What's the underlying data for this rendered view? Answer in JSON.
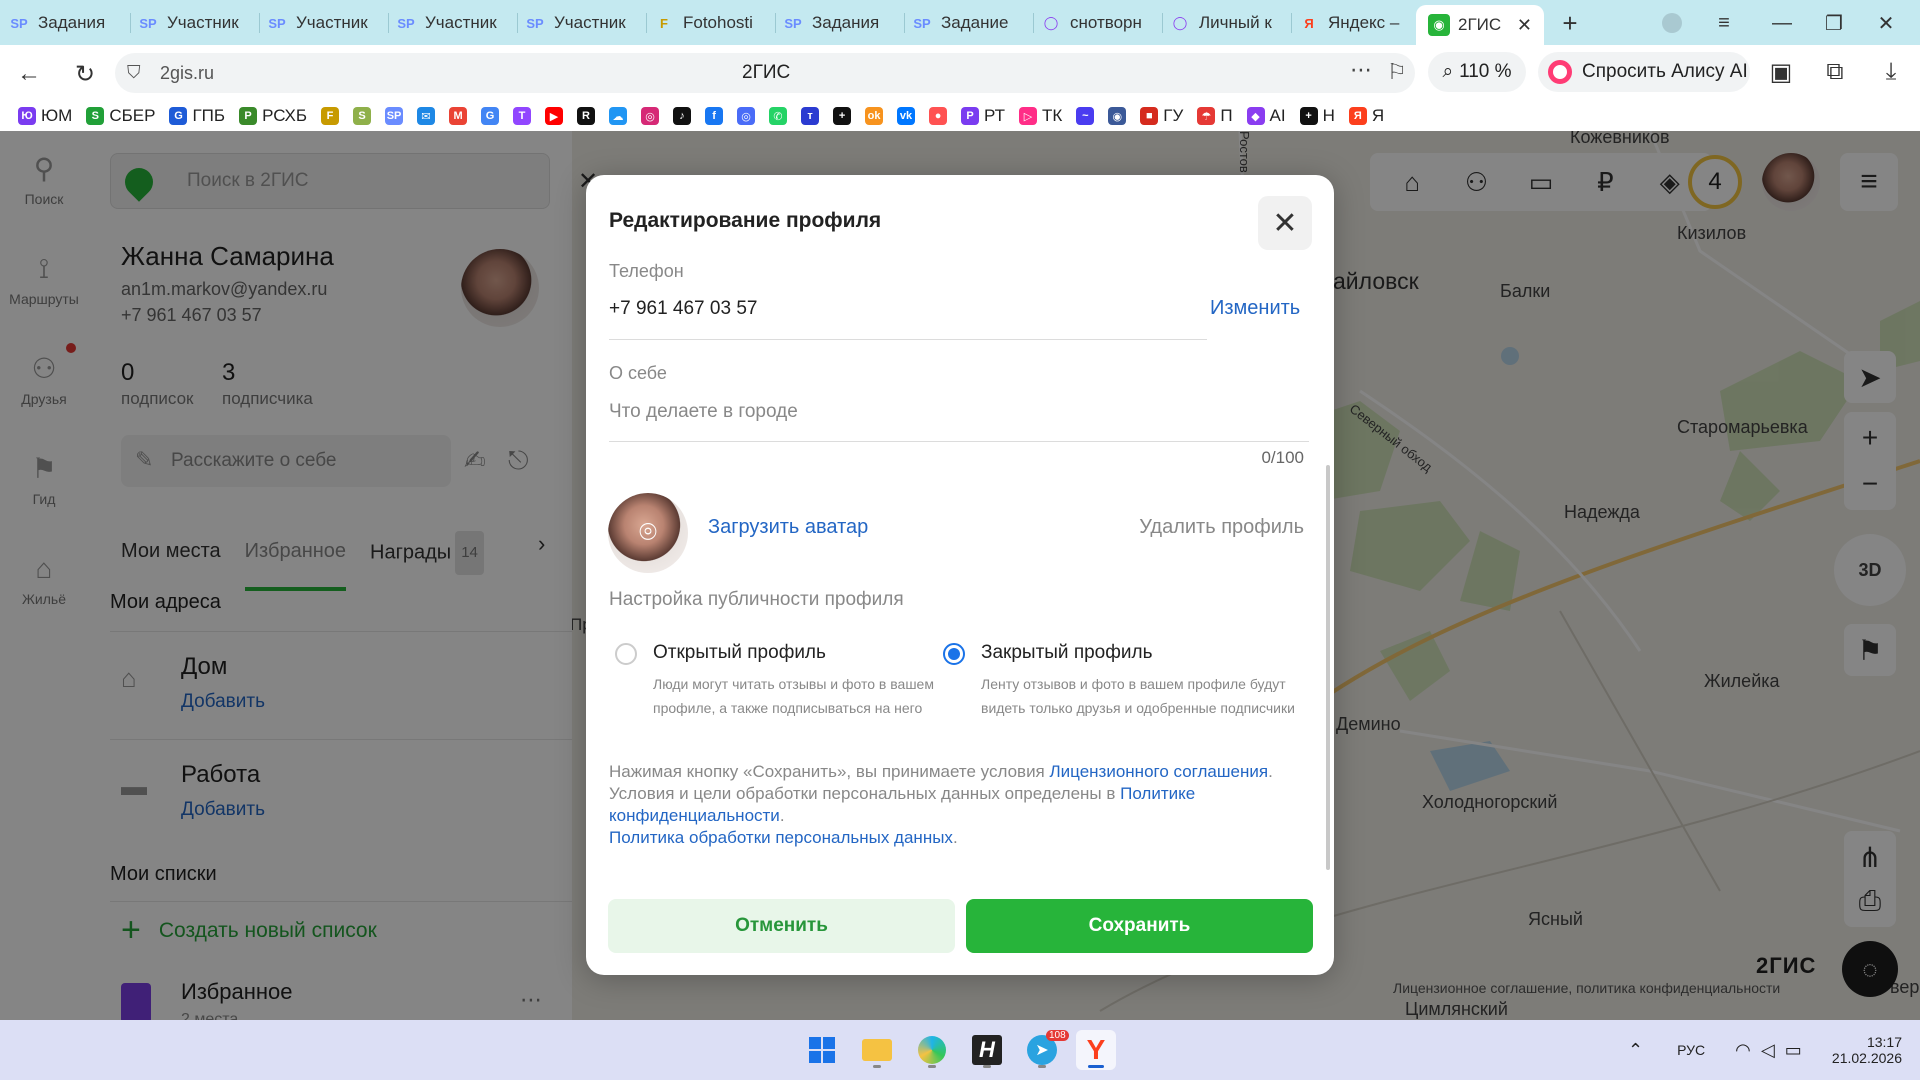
{
  "browser": {
    "tabs": [
      {
        "label": "Задания",
        "icon": "SP",
        "color": "#6a8cff"
      },
      {
        "label": "Участник",
        "icon": "SP",
        "color": "#6a8cff"
      },
      {
        "label": "Участник",
        "icon": "SP",
        "color": "#6a8cff"
      },
      {
        "label": "Участник",
        "icon": "SP",
        "color": "#6a8cff"
      },
      {
        "label": "Участник",
        "icon": "SP",
        "color": "#6a8cff"
      },
      {
        "label": "Fotohosti",
        "icon": "F",
        "color": "#c79a00"
      },
      {
        "label": "Задания",
        "icon": "SP",
        "color": "#6a8cff"
      },
      {
        "label": "Задание",
        "icon": "SP",
        "color": "#6a8cff"
      },
      {
        "label": "снотворн",
        "icon": "◯",
        "color": "#8a3df0"
      },
      {
        "label": "Личный к",
        "icon": "◯",
        "color": "#8a3df0"
      },
      {
        "label": "Яндекс –",
        "icon": "Я",
        "color": "#fc3f1d"
      }
    ],
    "active_tab": {
      "label": "2ГИС",
      "icon": "2"
    },
    "url": "2gis.ru",
    "page_title": "2ГИС",
    "zoom": "110 %",
    "alice_label": "Спросить Алису AI",
    "bookmarks": [
      {
        "label": "ЮМ",
        "icon": "Ю",
        "color": "#7a3cf0"
      },
      {
        "label": "СБЕР",
        "icon": "S",
        "color": "#21a038"
      },
      {
        "label": "ГПБ",
        "icon": "G",
        "color": "#1e5bd7"
      },
      {
        "label": "РСХБ",
        "icon": "Р",
        "color": "#3a8a2a"
      },
      {
        "label": "",
        "icon": "F",
        "color": "#c79a00"
      },
      {
        "label": "",
        "icon": "S",
        "color": "#8fb04a"
      },
      {
        "label": "",
        "icon": "SP",
        "color": "#6a8cff"
      },
      {
        "label": "",
        "icon": "✉",
        "color": "#1e88e5"
      },
      {
        "label": "",
        "icon": "M",
        "color": "#ea4335"
      },
      {
        "label": "",
        "icon": "G",
        "color": "#4285f4"
      },
      {
        "label": "",
        "icon": "T",
        "color": "#9146ff"
      },
      {
        "label": "",
        "icon": "▶",
        "color": "#ff0000"
      },
      {
        "label": "",
        "icon": "R",
        "color": "#111111"
      },
      {
        "label": "",
        "icon": "☁",
        "color": "#2196f3"
      },
      {
        "label": "",
        "icon": "◎",
        "color": "#d62976"
      },
      {
        "label": "",
        "icon": "♪",
        "color": "#111111"
      },
      {
        "label": "",
        "icon": "f",
        "color": "#1877f2"
      },
      {
        "label": "",
        "icon": "◎",
        "color": "#4a6cf7"
      },
      {
        "label": "",
        "icon": "✆",
        "color": "#25d366"
      },
      {
        "label": "",
        "icon": "т",
        "color": "#2b3bd1"
      },
      {
        "label": "",
        "icon": "+",
        "color": "#111111"
      },
      {
        "label": "",
        "icon": "ok",
        "color": "#f7931e"
      },
      {
        "label": "",
        "icon": "vk",
        "color": "#0077ff"
      },
      {
        "label": "",
        "icon": "●",
        "color": "#ff5252"
      },
      {
        "label": "РТ",
        "icon": "Р",
        "color": "#7a3cf0"
      },
      {
        "label": "ТК",
        "icon": "▷",
        "color": "#ff2d87"
      },
      {
        "label": "",
        "icon": "~",
        "color": "#4a3cf0"
      },
      {
        "label": "",
        "icon": "◉",
        "color": "#3b5998"
      },
      {
        "label": "ГУ",
        "icon": "■",
        "color": "#d52b1e"
      },
      {
        "label": "П",
        "icon": "☂",
        "color": "#e53935"
      },
      {
        "label": "AI",
        "icon": "◆",
        "color": "#8a3df0"
      },
      {
        "label": "Н",
        "icon": "+",
        "color": "#111111"
      },
      {
        "label": "Я",
        "icon": "Я",
        "color": "#fc3f1d"
      }
    ]
  },
  "rail": {
    "items": [
      {
        "label": "Поиск",
        "icon": "⚲"
      },
      {
        "label": "Маршруты",
        "icon": "⟟"
      },
      {
        "label": "Друзья",
        "icon": "⚇"
      },
      {
        "label": "Гид",
        "icon": "⚑"
      },
      {
        "label": "Жильё",
        "icon": "⌂"
      }
    ]
  },
  "side": {
    "search_placeholder": "Поиск в 2ГИС",
    "user_name": "Жанна Самарина",
    "email": "an1m.markov@yandex.ru",
    "phone": "+7 961 467 03 57",
    "followings_count": "0",
    "followings_label": "подписок",
    "followers_count": "3",
    "followers_label": "подписчика",
    "about_placeholder": "Расскажите о себе",
    "tabs": [
      "Мои места",
      "Избранное",
      "Награды"
    ],
    "awards_badge": "14",
    "addresses_title": "Мои адреса",
    "home_label": "Дом",
    "home_action": "Добавить",
    "work_label": "Работа",
    "work_action": "Добавить",
    "lists_title": "Мои списки",
    "new_list_label": "Создать новый список",
    "favorites_label": "Избранное",
    "favorites_sub": "2 места"
  },
  "map": {
    "level": "4",
    "btn_3d": "3D",
    "logo": "2ГИС",
    "legal": "Лицензионное соглашение, политика конфиденциальности",
    "road_label": "Северный обход",
    "road_label2": "Ростов",
    "partial_label": "Пр",
    "partial_label2": "вер",
    "places": [
      "Кизилов",
      "айловск",
      "Балки",
      "Старомарьевка",
      "Надежда",
      "Жилейка",
      "Демино",
      "Холодногорский",
      "Ясный",
      "Цимлянский",
      "Кожевников"
    ]
  },
  "modal": {
    "title": "Редактирование профиля",
    "phone_label": "Телефон",
    "phone_value": "+7 961 467 03 57",
    "change_label": "Изменить",
    "about_label": "О себе",
    "about_placeholder": "Что делаете в городе",
    "about_counter": "0/100",
    "upload_avatar": "Загрузить аватар",
    "delete_profile": "Удалить профиль",
    "privacy_title": "Настройка публичности профиля",
    "open_title": "Открытый профиль",
    "open_desc": "Люди могут читать отзывы и фото в вашем профиле, а также подписываться на него",
    "closed_title": "Закрытый профиль",
    "closed_desc": "Ленту отзывов и фото в вашем профиле будут видеть только друзья и одобренные подписчики",
    "closed_selected": true,
    "legal_1": "Нажимая кнопку «Сохранить», вы принимаете условия ",
    "legal_link_1": "Лицензионного соглашения",
    "legal_2": ". Условия и цели обработки персональных данных определены в ",
    "legal_link_2": "Политике конфиденциальности",
    "legal_3": ".",
    "legal_link_3": "Политика обработки персональных данных",
    "legal_4": ".",
    "cancel_label": "Отменить",
    "save_label": "Сохранить"
  },
  "taskbar": {
    "telegram_badge": "108",
    "lang": "РУС",
    "time": "13:17",
    "date": "21.02.2026"
  },
  "colors": {
    "accent_green": "#27b43a",
    "link_blue": "#2366c4",
    "radio_blue": "#1a73e8"
  }
}
